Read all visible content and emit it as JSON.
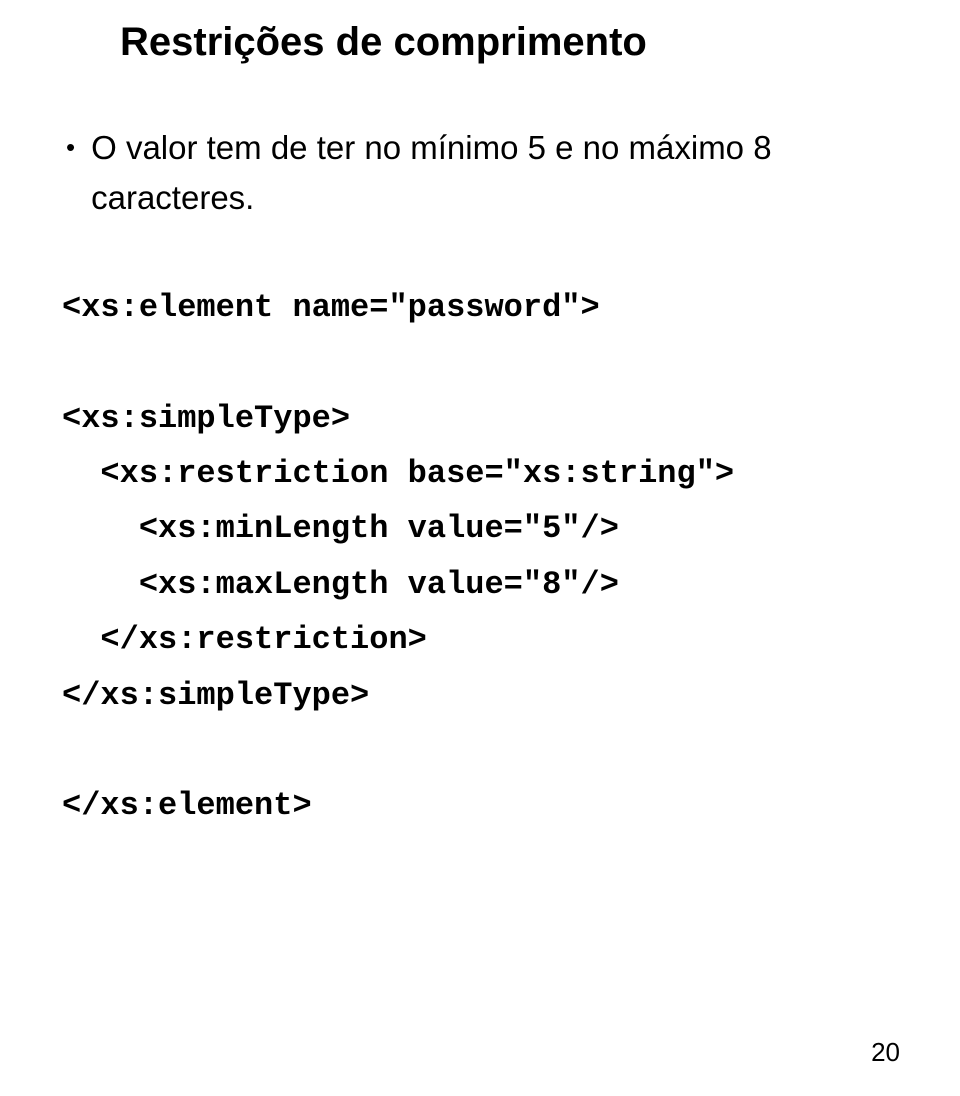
{
  "heading": "Restrições de comprimento",
  "bullet_text": "O valor tem de ter no mínimo 5 e no máximo 8 caracteres.",
  "code": {
    "l1": "<xs:element name=\"password\">",
    "l2": "",
    "l3": "<xs:simpleType>",
    "l4": "  <xs:restriction base=\"xs:string\">",
    "l5": "    <xs:minLength value=\"5\"/>",
    "l6": "    <xs:maxLength value=\"8\"/>",
    "l7": "  </xs:restriction>",
    "l8": "</xs:simpleType>",
    "l9": "",
    "l10": "</xs:element>"
  },
  "page_number": "20"
}
